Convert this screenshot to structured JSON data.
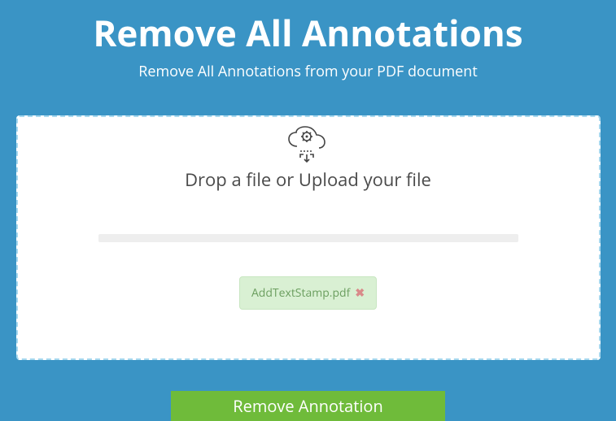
{
  "header": {
    "title": "Remove All Annotations",
    "subtitle": "Remove All Annotations from your PDF document"
  },
  "dropzone": {
    "instruction": "Drop a file or Upload your file",
    "icon_name": "cloud-upload-gear-icon"
  },
  "file": {
    "name": "AddTextStamp.pdf",
    "remove_icon": "✖"
  },
  "action": {
    "button_label": "Remove Annotation"
  },
  "colors": {
    "background": "#3a94c5",
    "button": "#6fbb3a",
    "file_pill_bg": "#d9f0d3",
    "file_pill_text": "#6b9e5f"
  }
}
